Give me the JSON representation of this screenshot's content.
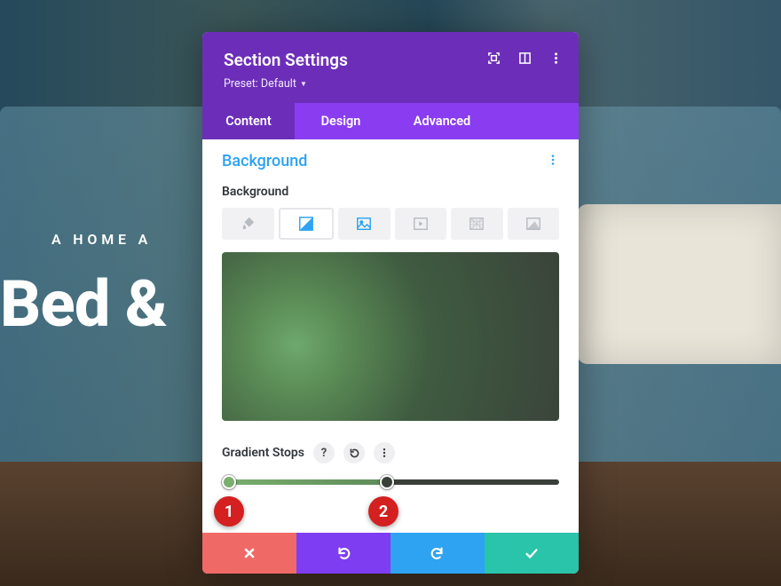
{
  "hero": {
    "subhead": "A HOME A",
    "title": "Bed &"
  },
  "panel": {
    "title": "Section Settings",
    "preset_label": "Preset: Default",
    "tabs": {
      "content": "Content",
      "design": "Design",
      "advanced": "Advanced"
    },
    "section_heading": "Background",
    "background_label": "Background",
    "bg_tab_names": {
      "fill": "fill-icon",
      "gradient": "gradient-icon",
      "image": "image-icon",
      "video": "video-icon",
      "pattern": "pattern-icon",
      "mask": "mask-icon"
    },
    "gradient": {
      "label": "Gradient Stops",
      "help": "?",
      "stops": [
        {
          "color": "#7aaf6e",
          "position_pct": 2
        },
        {
          "color": "#3a3f3a",
          "position_pct": 49
        }
      ]
    }
  },
  "footer": {
    "close": "close",
    "undo": "undo",
    "redo": "redo",
    "save": "save"
  },
  "annotations": {
    "one": "1",
    "two": "2"
  }
}
